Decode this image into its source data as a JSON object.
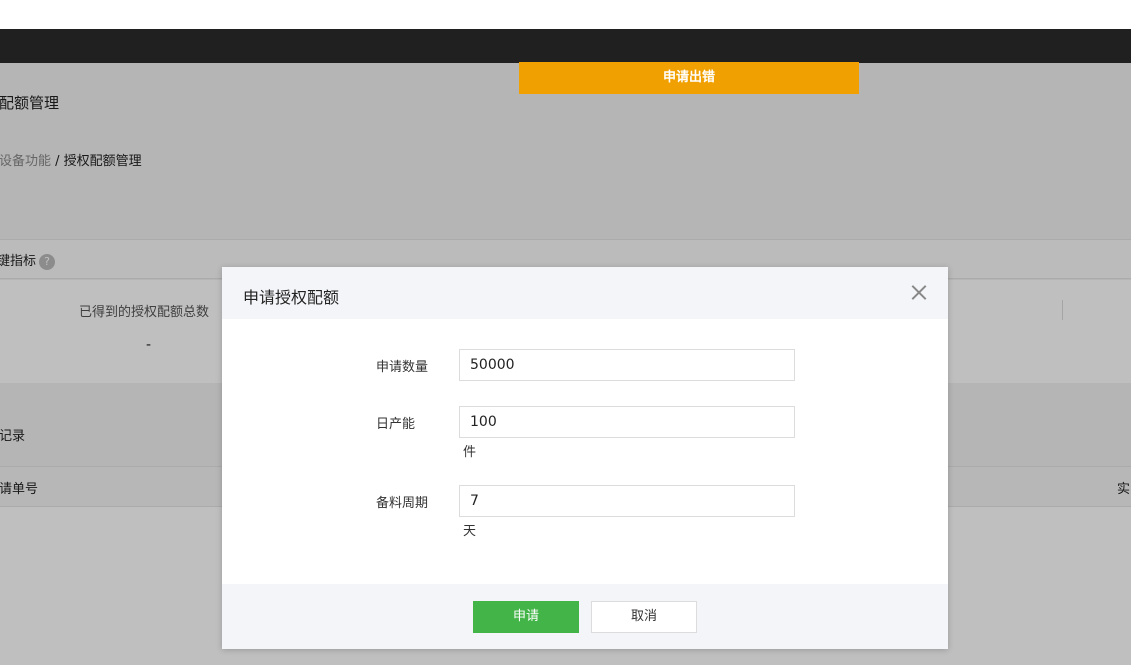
{
  "page": {
    "title": "配额管理",
    "breadcrumb": {
      "parent": "设备功能",
      "separator": " / ",
      "current": "授权配额管理"
    },
    "metrics": {
      "title": "键指标",
      "help_icon": "?",
      "label": "已得到的授权配额总数",
      "value": "-"
    },
    "records": {
      "title": "记录"
    },
    "table": {
      "columns": [
        "请单号",
        "实"
      ]
    }
  },
  "toast": {
    "message": "申请出错",
    "color": "#f0a000"
  },
  "dialog": {
    "title": "申请授权配额",
    "fields": [
      {
        "label": "申请数量",
        "value": "50000",
        "unit": ""
      },
      {
        "label": "日产能",
        "value": "100",
        "unit": "件"
      },
      {
        "label": "备料周期",
        "value": "7",
        "unit": "天"
      }
    ],
    "buttons": {
      "submit": "申请",
      "cancel": "取消"
    },
    "primary_color": "#43b548"
  }
}
